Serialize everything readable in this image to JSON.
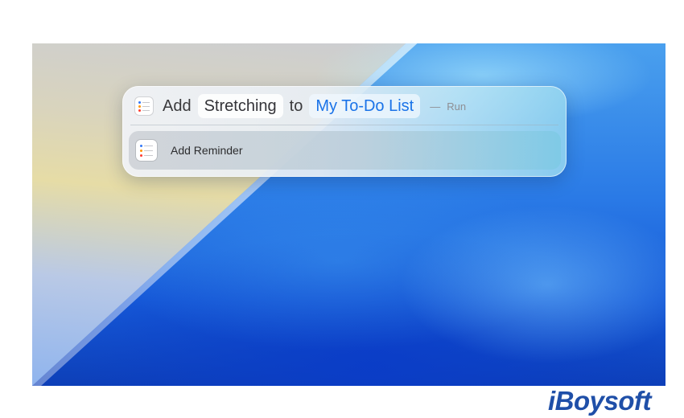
{
  "shortcut": {
    "app_icon": "reminders-icon",
    "verb": "Add",
    "item_token": "Stretching",
    "preposition": "to",
    "list_token": "My To-Do List",
    "separator": "—",
    "action_hint": "Run"
  },
  "result": {
    "app_icon": "reminders-icon",
    "label": "Add Reminder"
  },
  "watermark": {
    "text": "iBoysoft"
  },
  "colors": {
    "list_token_text": "#1a73e8",
    "reminder_dot_blue": "#3478f6",
    "reminder_dot_orange": "#ff9500",
    "reminder_dot_red": "#ff3b30",
    "logo": "#1f4fa8"
  }
}
